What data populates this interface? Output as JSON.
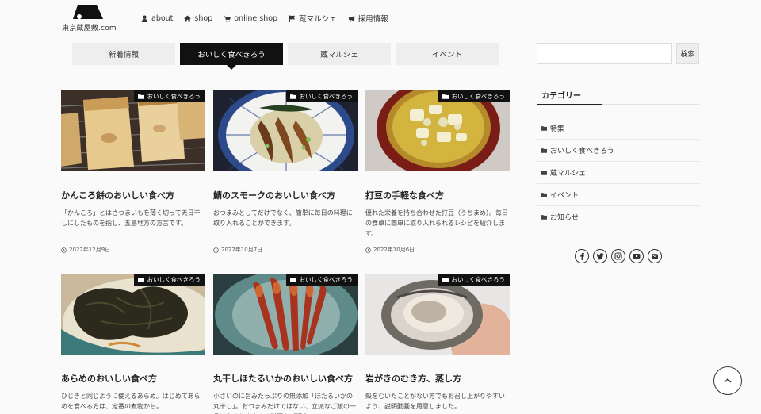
{
  "site": {
    "logo_text": "東京蔵屋敷.com"
  },
  "nav": [
    {
      "label": "about",
      "icon": "user-icon"
    },
    {
      "label": "shop",
      "icon": "home-icon"
    },
    {
      "label": "online shop",
      "icon": "cart-icon"
    },
    {
      "label": "蔵マルシェ",
      "icon": "flag-icon"
    },
    {
      "label": "採用情報",
      "icon": "megaphone-icon"
    }
  ],
  "tabs": [
    {
      "label": "新着情報",
      "active": false
    },
    {
      "label": "おいしく食べきろう",
      "active": true
    },
    {
      "label": "蔵マルシェ",
      "active": false
    },
    {
      "label": "イベント",
      "active": false
    }
  ],
  "posts": [
    {
      "category": "おいしく食べきろう",
      "title": "かんころ餅のおいしい食べ方",
      "excerpt": "「かんころ」とはさつまいもを薄く切って天日干しにしたものを指し、五島地方の方言です。",
      "date": "2022年12月9日"
    },
    {
      "category": "おいしく食べきろう",
      "title": "鯖のスモークのおいしい食べ方",
      "excerpt": "おつまみとしてだけでなく、簡単に毎日の料理に取り入れることができます。",
      "date": "2022年10月7日"
    },
    {
      "category": "おいしく食べきろう",
      "title": "打豆の手軽な食べ方",
      "excerpt": "優れた栄養を持ち合わせた打豆（うちまめ）。毎日の食卓に簡単に取り入れられるレシピを紹介します。",
      "date": "2022年10月6日"
    },
    {
      "category": "おいしく食べきろう",
      "title": "あらめのおいしい食べ方",
      "excerpt": "ひじきと同じように使えるあらめ。はじめてあらめを食べる方は、定番の煮物から。",
      "date": ""
    },
    {
      "category": "おいしく食べきろう",
      "title": "丸干しほたるいかのおいしい食べ方",
      "excerpt": "小さいのに旨みたっぷりの無添加「ほたるいかの丸干し」。おつまみだけではない、立派なご飯の一品になるおすすめの料理をご紹介",
      "date": ""
    },
    {
      "category": "おいしく食べきろう",
      "title": "岩がきのむき方、蒸し方",
      "excerpt": "殻をむいたことがない方でもお召し上がりやすいよう、説明動画を用意しました。",
      "date": ""
    }
  ],
  "search": {
    "placeholder": "",
    "button_label": "検索"
  },
  "sidebar": {
    "category_title": "カテゴリー",
    "categories": [
      "特集",
      "おいしく食べきろう",
      "蔵マルシェ",
      "イベント",
      "お知らせ"
    ]
  },
  "social_icons": [
    "facebook-icon",
    "twitter-icon",
    "instagram-icon",
    "youtube-icon",
    "mail-icon"
  ],
  "colors": {
    "accent": "#111111",
    "tab_bg": "#eeeeee",
    "background": "#fafafa"
  }
}
